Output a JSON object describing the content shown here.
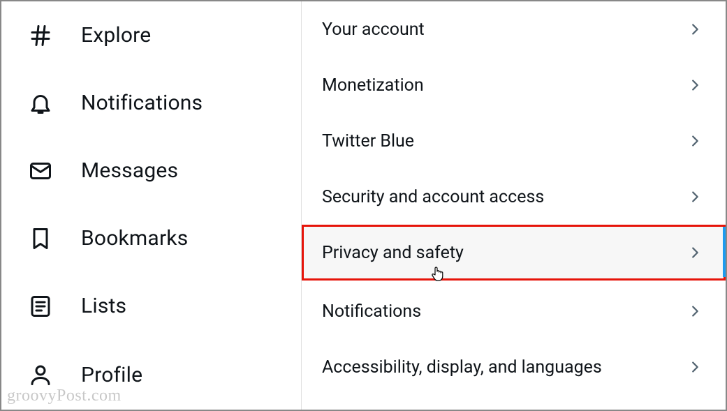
{
  "sidebar": {
    "items": [
      {
        "icon": "hash-icon",
        "label": "Explore"
      },
      {
        "icon": "bell-icon",
        "label": "Notifications"
      },
      {
        "icon": "mail-icon",
        "label": "Messages"
      },
      {
        "icon": "bookmark-icon",
        "label": "Bookmarks"
      },
      {
        "icon": "list-icon",
        "label": "Lists"
      },
      {
        "icon": "profile-icon",
        "label": "Profile"
      }
    ]
  },
  "settings": {
    "items": [
      {
        "label": "Your account",
        "selected": false
      },
      {
        "label": "Monetization",
        "selected": false
      },
      {
        "label": "Twitter Blue",
        "selected": false
      },
      {
        "label": "Security and account access",
        "selected": false
      },
      {
        "label": "Privacy and safety",
        "selected": true
      },
      {
        "label": "Notifications",
        "selected": false
      },
      {
        "label": "Accessibility, display, and languages",
        "selected": false
      }
    ],
    "accent_color": "#1d9bf0",
    "highlight_color": "#e6140a"
  },
  "watermark": "groovyPost.com"
}
